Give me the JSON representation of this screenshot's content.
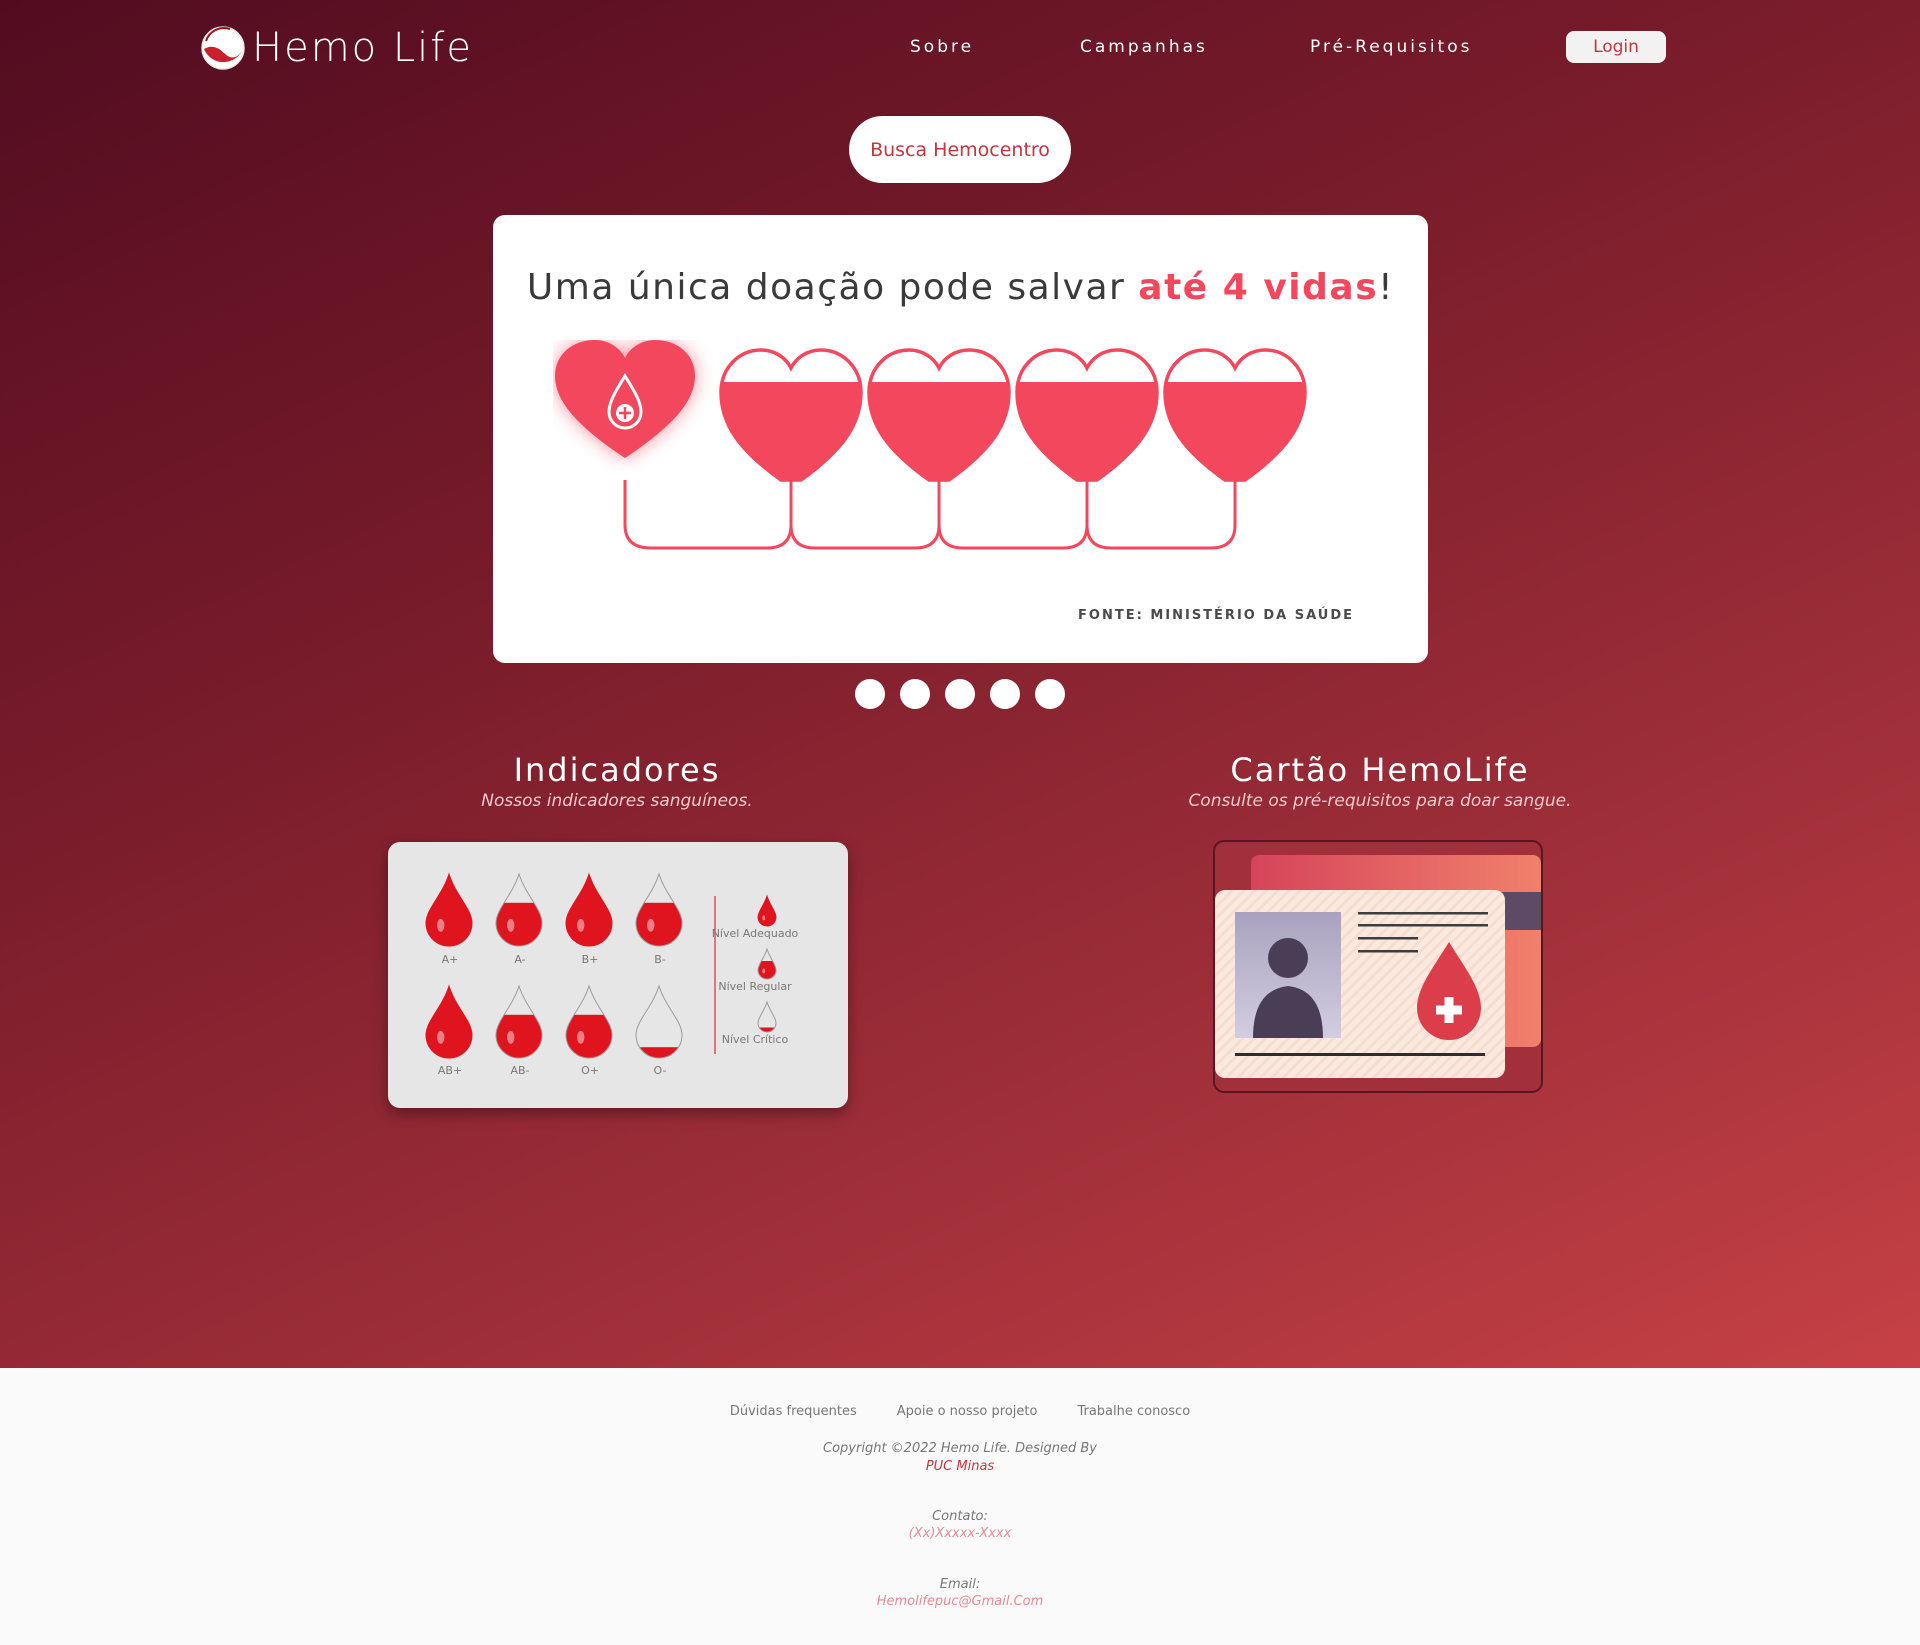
{
  "nav": {
    "logo_text": "Hemo Life",
    "links": [
      "Sobre",
      "Campanhas",
      "Pré-Requisitos"
    ],
    "login_label": "Login"
  },
  "hero": {
    "search_button": "Busca Hemocentro"
  },
  "carousel": {
    "title_prefix": "Uma única doação pode salvar ",
    "title_highlight": "até 4 vidas",
    "title_suffix": "!",
    "source": "FONTE: MINISTÉRIO DA SAÚDE",
    "slide_count": 5,
    "highlight_color": "#f2475d"
  },
  "indicators": {
    "title": "Indicadores",
    "subtitle": "Nossos indicadores sanguíneos.",
    "blood_types": [
      {
        "label": "A+",
        "level": 1.0
      },
      {
        "label": "A-",
        "level": 0.6
      },
      {
        "label": "B+",
        "level": 1.0
      },
      {
        "label": "B-",
        "level": 0.6
      },
      {
        "label": "AB+",
        "level": 1.0
      },
      {
        "label": "AB-",
        "level": 0.6
      },
      {
        "label": "O+",
        "level": 0.6
      },
      {
        "label": "O-",
        "level": 0.15
      }
    ],
    "legend": [
      "Nível Adequado",
      "Nível Regular",
      "Nível Crítico"
    ]
  },
  "card_section": {
    "title": "Cartão HemoLife",
    "subtitle": "Consulte os pré-requisitos para doar sangue."
  },
  "footer": {
    "links": [
      "Dúvidas frequentes",
      "Apoie o nosso projeto",
      "Trabalhe conosco"
    ],
    "copyright": "Copyright ©2022 Hemo Life. Designed By",
    "designer": "PUC Minas",
    "contact_label": "Contato:",
    "contact_value": "(Xx)Xxxxx-Xxxx",
    "email_label": "Email:",
    "email_value": "Hemolifepuc@Gmail.Com"
  },
  "colors": {
    "brand_red": "#c8343d",
    "blood": "#e0141f"
  }
}
